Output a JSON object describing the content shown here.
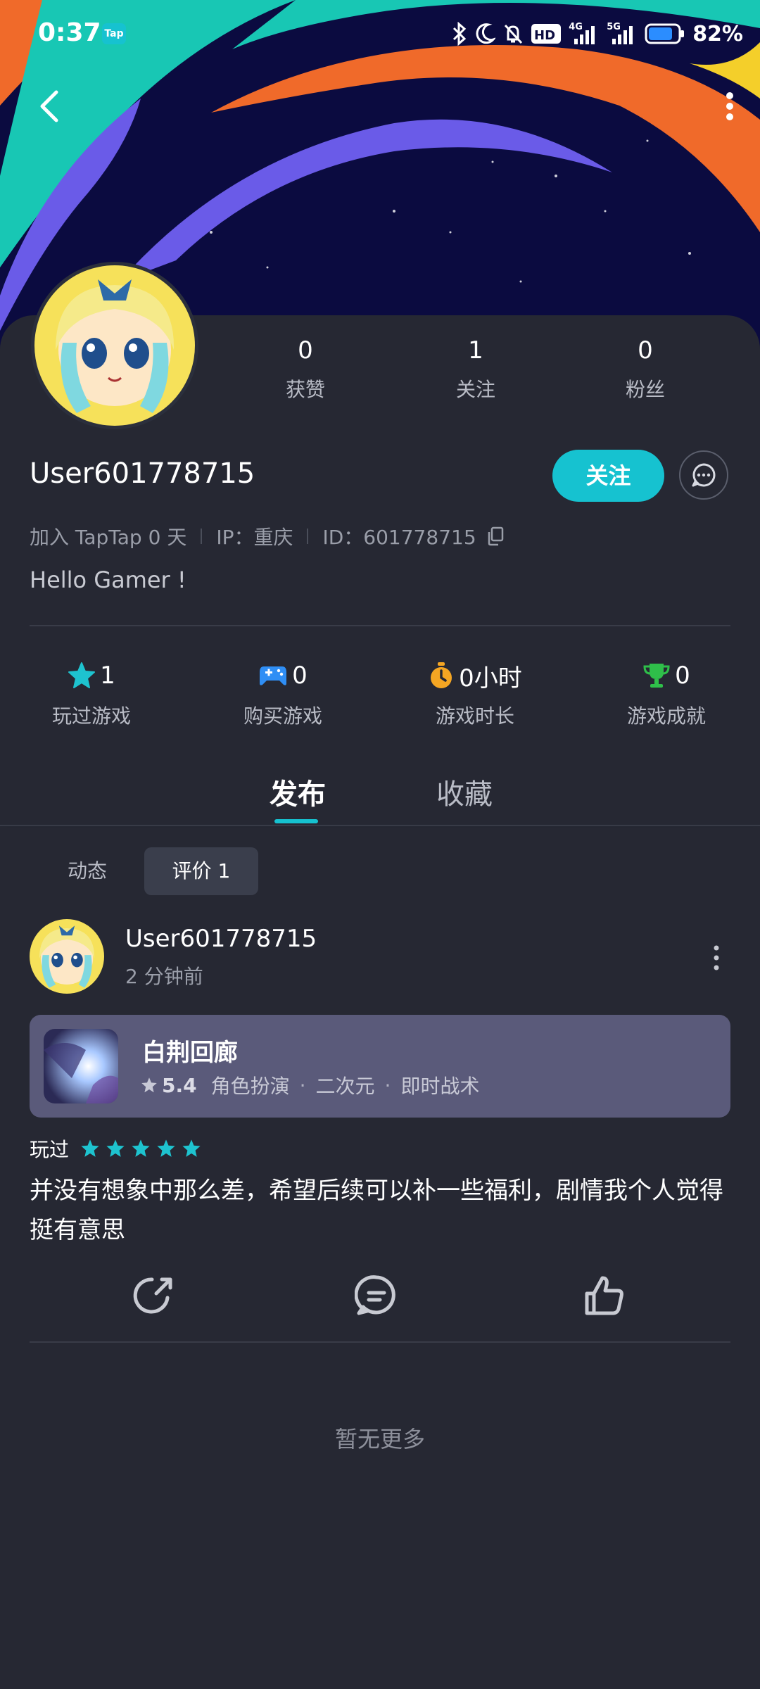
{
  "status_bar": {
    "time": "0:37",
    "app_badge": "Tap",
    "network_4g": "4G",
    "network_5g": "5G",
    "hd_label": "HD",
    "battery_percent": "82%",
    "icons": [
      "bluetooth-icon",
      "moon-icon",
      "mute-icon",
      "hd-icon",
      "signal-icon",
      "signal-icon",
      "battery-icon"
    ]
  },
  "profile": {
    "username": "User601778715",
    "counts": [
      {
        "value": "0",
        "label": "获赞"
      },
      {
        "value": "1",
        "label": "关注"
      },
      {
        "value": "0",
        "label": "粉丝"
      }
    ],
    "follow_label": "关注",
    "joined": "加入 TapTap 0 天",
    "ip": "IP：重庆",
    "id": "ID：601778715",
    "bio": "Hello Gamer !"
  },
  "stats": [
    {
      "icon": "star-icon",
      "value": "1",
      "label": "玩过游戏"
    },
    {
      "icon": "gamepad-icon",
      "value": "0",
      "label": "购买游戏"
    },
    {
      "icon": "stopwatch-icon",
      "value": "0小时",
      "label": "游戏时长"
    },
    {
      "icon": "trophy-icon",
      "value": "0",
      "label": "游戏成就"
    }
  ],
  "tabs": [
    {
      "label": "发布",
      "active": true
    },
    {
      "label": "收藏",
      "active": false
    }
  ],
  "subtabs": [
    {
      "label": "动态",
      "active": false
    },
    {
      "label": "评价 1",
      "active": true
    }
  ],
  "post": {
    "username": "User601778715",
    "time": "2 分钟前",
    "game": {
      "title": "白荆回廊",
      "score": "5.4",
      "tags": [
        "角色扮演",
        "二次元",
        "即时战术"
      ]
    },
    "played_label": "玩过",
    "rating_stars": 5,
    "review": "并没有想象中那么差，希望后续可以补一些福利，剧情我个人觉得挺有意思"
  },
  "footer": {
    "no_more": "暂无更多"
  },
  "colors": {
    "accent": "#16c2d0",
    "background": "#262833",
    "game_card": "#5a5a7a",
    "star_icon": "#1ec3cf",
    "gamepad_icon": "#2f8ef5",
    "stopwatch_icon": "#f5a623",
    "trophy_icon": "#2fbf4a"
  }
}
